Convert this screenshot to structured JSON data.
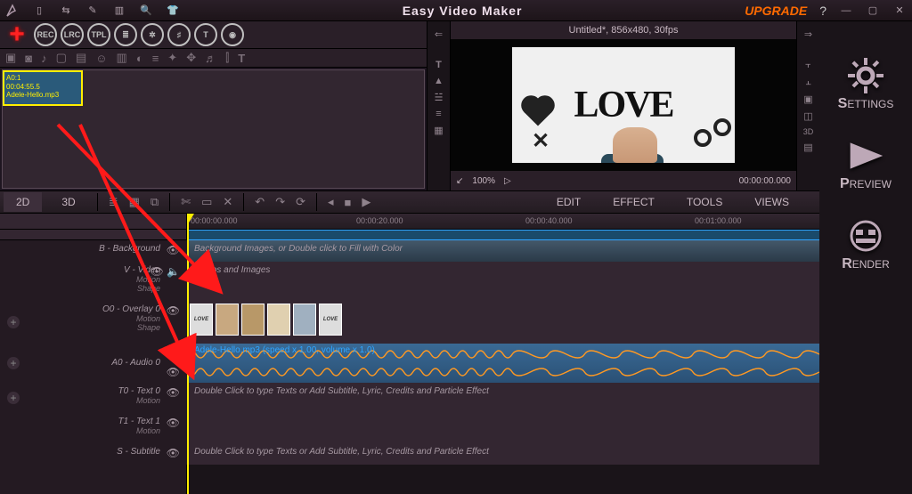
{
  "app": {
    "title": "Easy Video Maker",
    "upgrade": "UPGRADE",
    "help": "?"
  },
  "mediabar": {
    "rec": "REC",
    "lrc": "LRC",
    "tpl": "TPL"
  },
  "media_clip": {
    "id": "A0:1",
    "duration": "00:04:55.5",
    "name": "Adele-Hello.mp3"
  },
  "preview": {
    "title": "Untitled*, 856x480, 30fps",
    "zoom": "100%",
    "playtime": "00:00:00.000",
    "art_text": "LOVE"
  },
  "timeline": {
    "tab2d": "2D",
    "tab3d": "3D",
    "menus": [
      "EDIT",
      "EFFECT",
      "TOOLS",
      "VIEWS"
    ],
    "ruler": [
      "00:00:00.000",
      "00:00:20.000",
      "00:00:40.000",
      "00:01:00.000"
    ],
    "tracks": {
      "bg": {
        "label": "B - Background",
        "hint": "Background Images, or Double click to Fill with Color"
      },
      "video": {
        "label": "V - Video",
        "hint": "Videos and Images",
        "sub1": "Motion",
        "sub2": "Shape"
      },
      "overlay": {
        "label": "O0 - Overlay 0",
        "sub1": "Motion",
        "sub2": "Shape"
      },
      "audio": {
        "label": "A0 - Audio 0",
        "clip": "Adele-Hello.mp3  (speed x 1.00, volume x 1.0)"
      },
      "text0": {
        "label": "T0 - Text 0",
        "hint": "Double Click to type Texts or Add Subtitle, Lyric, Credits and Particle Effect",
        "sub": "Motion"
      },
      "text1": {
        "label": "T1 - Text 1",
        "sub": "Motion"
      },
      "sub": {
        "label": "S - Subtitle",
        "hint": "Double Click to type Texts or Add Subtitle, Lyric, Credits and Particle Effect"
      }
    }
  },
  "sidebar": {
    "settings": {
      "letter": "S",
      "rest": "ETTINGS"
    },
    "preview": {
      "letter": "P",
      "rest": "REVIEW"
    },
    "render": {
      "letter": "R",
      "rest": "ENDER"
    }
  }
}
